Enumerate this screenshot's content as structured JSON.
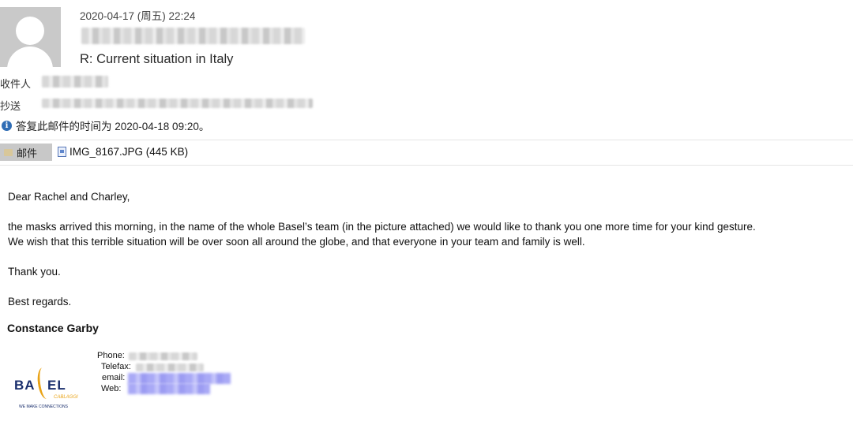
{
  "header": {
    "date": "2020-04-17 (周五) 22:24",
    "subject": "R: Current situation in Italy"
  },
  "recipients": {
    "to_label": "收件人",
    "cc_label": "抄送"
  },
  "info": {
    "icon": "info-icon",
    "text": "答复此邮件的时间为 2020-04-18 09:20。"
  },
  "attachments": {
    "mail_tab_label": "邮件",
    "file_name": "IMG_8167.JPG (445 KB)"
  },
  "body": {
    "greeting": "Dear Rachel and Charley,",
    "line1": "the masks arrived this morning, in the name of the whole Basel’s team (in the picture attached) we would like to thank you one more time for your kind gesture.",
    "line2": "We wish that this terrible situation will be over soon all around the globe, and that everyone in your team and family is well.",
    "thanks": "Thank you.",
    "regards": "Best regards."
  },
  "signature": {
    "name": "Constance Garby",
    "phone_label": "Phone:",
    "telefax_label": "Telefax:",
    "email_label": "email:",
    "web_label": "Web:",
    "logo": {
      "text_left": "BA",
      "text_right": "EL",
      "subtitle": "CABLAGGI",
      "tagline": "WE MAKE CONNECTIONS",
      "brand_color": "#1a2f6d",
      "accent_color": "#e9a316"
    }
  }
}
